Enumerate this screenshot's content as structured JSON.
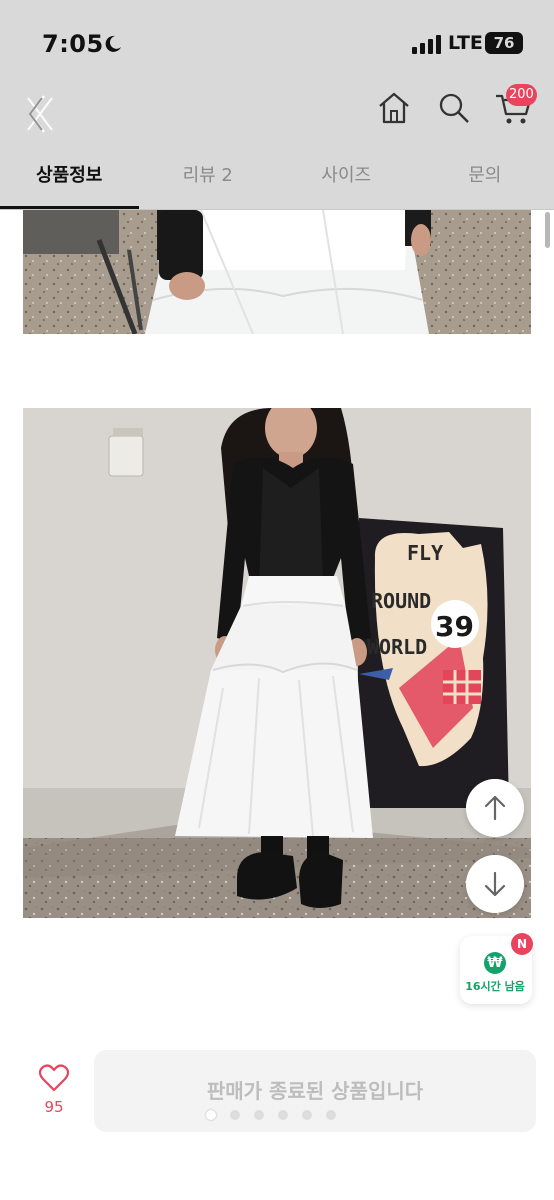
{
  "status_bar": {
    "time": "7:05",
    "network": "LTE",
    "battery": "76"
  },
  "header": {
    "icons": [
      "back-icon",
      "home-icon",
      "search-icon",
      "cart-icon"
    ],
    "cart_badge": "200"
  },
  "tabs": [
    {
      "label": "상품정보",
      "active": true
    },
    {
      "label": "리뷰 2",
      "active": false
    },
    {
      "label": "사이즈",
      "active": false
    },
    {
      "label": "문의",
      "active": false
    }
  ],
  "poster": {
    "line1": "FLY",
    "line2": "ROUND",
    "line3": "WORLD",
    "number": "39"
  },
  "floating": {
    "up_icon": "arrow-up-icon",
    "down_icon": "arrow-down-icon",
    "timer_badge": "N",
    "timer_icon_symbol": "₩",
    "timer_text": "16시간 남음"
  },
  "bottom_bar": {
    "like_count": "95",
    "sold_out_label": "판매가 종료된 상품입니다"
  },
  "colors": {
    "accent": "#e8445e",
    "green": "#12a36a",
    "header_bg": "#d9d9d9"
  }
}
